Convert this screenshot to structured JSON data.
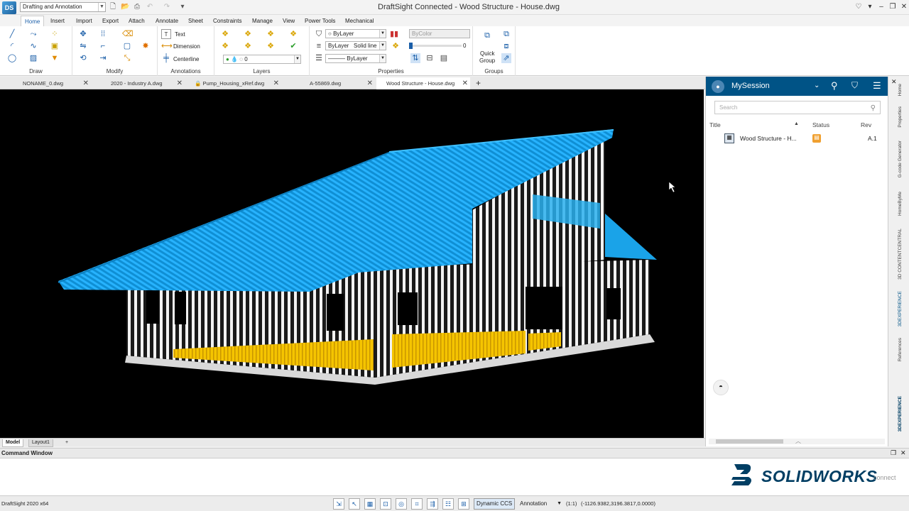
{
  "app": {
    "logo_text": "DS",
    "workspace": "Drafting and Annotation",
    "title": "DraftSight Connected - Wood Structure - House.dwg"
  },
  "menu_tabs": [
    "Home",
    "Insert",
    "Import",
    "Export",
    "Attach",
    "Annotate",
    "Sheet",
    "Constraints",
    "Manage",
    "View",
    "Power Tools",
    "Mechanical"
  ],
  "ribbon": {
    "panels": {
      "draw": "Draw",
      "modify": "Modify",
      "annotations": "Annotations",
      "layers": "Layers",
      "properties": "Properties",
      "groups": "Groups"
    },
    "annotations": {
      "text": "Text",
      "dimension": "Dimension",
      "centerline": "Centerline"
    },
    "layers": {
      "current_layer": "0"
    },
    "properties": {
      "color": "ByLayer",
      "bycolor": "ByColor",
      "linetype": "ByLayer",
      "linetype_style": "Solid line",
      "lineweight": "ByLayer",
      "transparency": "0"
    },
    "groups": {
      "quick_group_line1": "Quick",
      "quick_group_line2": "Group"
    }
  },
  "doc_tabs": [
    {
      "label": "NONAME_0.dwg",
      "locked": false,
      "active": false
    },
    {
      "label": "2020 - Industry A.dwg",
      "locked": false,
      "active": false
    },
    {
      "label": "Pump_Housing_xRef.dwg",
      "locked": true,
      "active": false
    },
    {
      "label": "A-55869.dwg",
      "locked": false,
      "active": false
    },
    {
      "label": "Wood Structure - House.dwg",
      "locked": false,
      "active": true
    }
  ],
  "layout_tabs": [
    "Model",
    "Layout1"
  ],
  "session": {
    "title": "MySession",
    "search_placeholder": "Search",
    "columns": {
      "title": "Title",
      "status": "Status",
      "rev": "Rev"
    },
    "rows": [
      {
        "title": "Wood Structure - H...",
        "rev": "A.1"
      }
    ]
  },
  "side_tabs": [
    "Home",
    "Properties",
    "G-code Generator",
    "HomeByMe",
    "3D CONTENTCENTRAL",
    "3DEXPERIENCE",
    "References"
  ],
  "side_brand": "3DEXPERIENCE",
  "command_window": {
    "title": "Command Window"
  },
  "brand": {
    "main": "SOLIDWORKS",
    "sub": "connect"
  },
  "status": {
    "app_version": "DraftSight 2020 x64",
    "dynamic_ccs": "Dynamic CCS",
    "annotation": "Annotation",
    "scale": "(1:1)",
    "coords": "(-1126.9382,3196.3817,0.0000)"
  },
  "colors": {
    "roof": "#1aa3e8",
    "wall": "#e8e8e8",
    "insulation": "#f2c200",
    "session_header": "#005386",
    "accent": "#1a5ea8"
  }
}
